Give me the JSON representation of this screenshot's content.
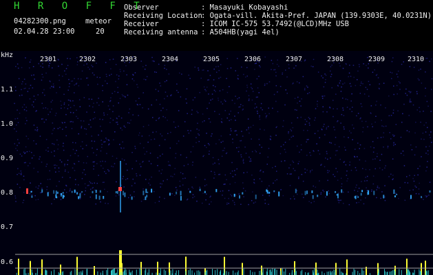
{
  "header": {
    "title": "H R O F F T",
    "filename": "04282300.png",
    "meteor_label": "meteor",
    "datetime": "02.04.28 23:00",
    "meteor_count": "20",
    "fields": [
      {
        "label": "Observer",
        "value": ": Masayuki Kobayashi"
      },
      {
        "label": "Receiving Location",
        "value": ": Ogata-vill. Akita-Pref. JAPAN (139.9303E, 40.0231N)"
      },
      {
        "label": "Receiver",
        "value": ": ICOM IC-575 53.7492(@LCD)MHz USB"
      },
      {
        "label": "Receiving antenna",
        "value": ": A504HB(yagi 4el)"
      }
    ]
  },
  "plot": {
    "y_unit": "kHz",
    "y_ticks": [
      "1.1",
      "1.0",
      "0.9",
      "0.8",
      "0.7",
      "0.6"
    ],
    "time_labels": [
      "2301",
      "2302",
      "2303",
      "2304",
      "2305",
      "2306",
      "2307",
      "2308",
      "2309",
      "2310"
    ],
    "colors": {
      "background": "#000010",
      "noise": "#2a2aa8",
      "echo": "#33aaff",
      "hot": "#ff4040",
      "bars": "#ffff33",
      "cyan": "#33dddd",
      "grid": "#a0a0a0",
      "text": "#f0f0f0"
    }
  }
}
